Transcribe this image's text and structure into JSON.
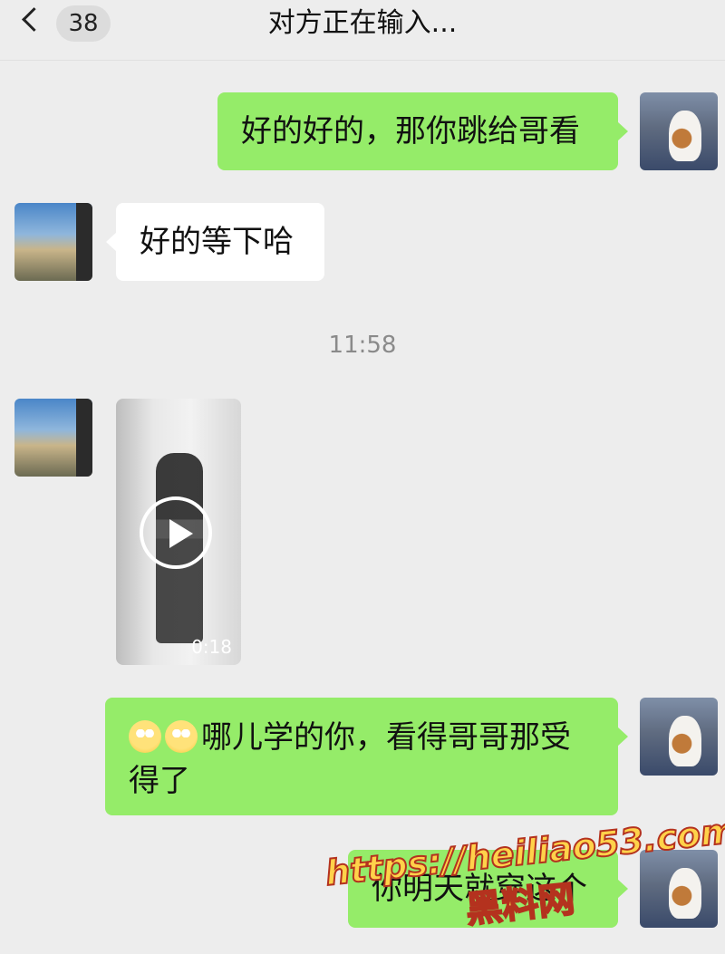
{
  "header": {
    "unread_count": "38",
    "title": "对方正在输入..."
  },
  "messages": [
    {
      "side": "right",
      "type": "text",
      "text": "好的好的，那你跳给哥看"
    },
    {
      "side": "left",
      "type": "text",
      "text": "好的等下哈"
    },
    {
      "type": "timestamp",
      "text": "11:58"
    },
    {
      "side": "left",
      "type": "video",
      "duration": "0:18"
    },
    {
      "side": "right",
      "type": "text",
      "emojis": [
        "flushed-face-emoji",
        "flushed-face-emoji"
      ],
      "text": "哪儿学的你，看得哥哥那受得了"
    },
    {
      "side": "right",
      "type": "text",
      "text": "你明天就穿这个"
    }
  ],
  "watermark": {
    "url": "https://heiliao53.com",
    "name": "黑料网"
  },
  "colors": {
    "background": "#ededed",
    "sent_bubble": "#95ec69",
    "received_bubble": "#ffffff"
  }
}
